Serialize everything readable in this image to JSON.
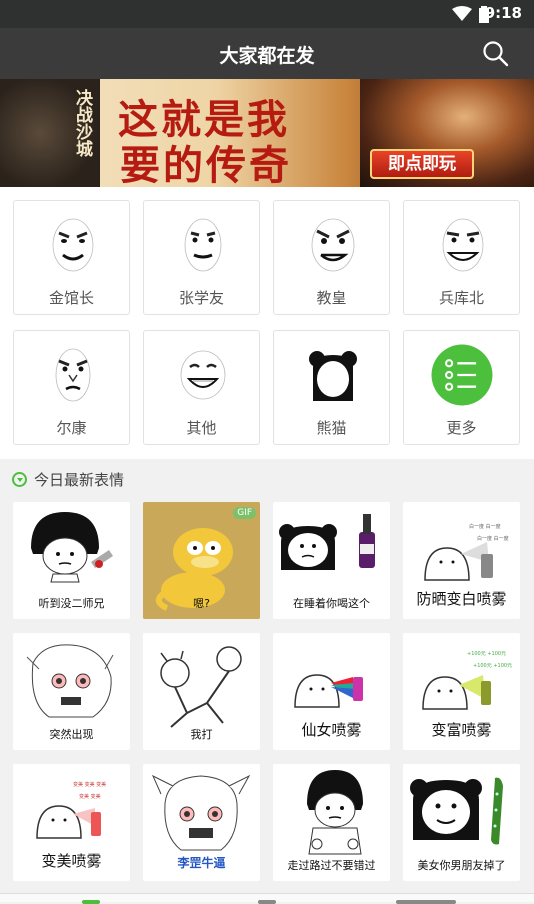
{
  "status_bar": {
    "time": "9:18"
  },
  "header": {
    "title": "大家都在发",
    "search_icon": "search-icon"
  },
  "banner": {
    "side_text": "决战沙城",
    "line1": "这就是我",
    "line2": "要的传奇",
    "play_label": "即点即玩"
  },
  "categories": [
    {
      "label": "金馆长",
      "icon": "meme-face-icon"
    },
    {
      "label": "张学友",
      "icon": "meme-face-icon"
    },
    {
      "label": "教皇",
      "icon": "meme-face-icon"
    },
    {
      "label": "兵库北",
      "icon": "meme-face-icon"
    },
    {
      "label": "尔康",
      "icon": "meme-face-icon"
    },
    {
      "label": "其他",
      "icon": "meme-face-icon"
    },
    {
      "label": "熊猫",
      "icon": "panda-icon"
    },
    {
      "label": "更多",
      "icon": "list-icon"
    }
  ],
  "section_title": "今日最新表情",
  "memes": [
    {
      "caption": "听到没二师兄",
      "gif": false
    },
    {
      "caption": "嗯?",
      "gif": true,
      "gif_label": "GIF"
    },
    {
      "caption": "在睡着你喝这个",
      "gif": false
    },
    {
      "caption": "防晒变白喷雾",
      "gif": false
    },
    {
      "caption": "突然出现",
      "gif": false
    },
    {
      "caption": "我打",
      "gif": false
    },
    {
      "caption": "仙女喷雾",
      "gif": false
    },
    {
      "caption": "变富喷雾",
      "gif": false
    },
    {
      "caption": "变美喷雾",
      "gif": false
    },
    {
      "caption": "李罡牛逼",
      "gif": false
    },
    {
      "caption": "走过路过不要错过",
      "gif": false
    },
    {
      "caption": "美女你男朋友掉了",
      "gif": false
    }
  ],
  "colors": {
    "accent": "#4cbf3d",
    "topbar": "#3b3b3b",
    "status": "#2f3030"
  }
}
